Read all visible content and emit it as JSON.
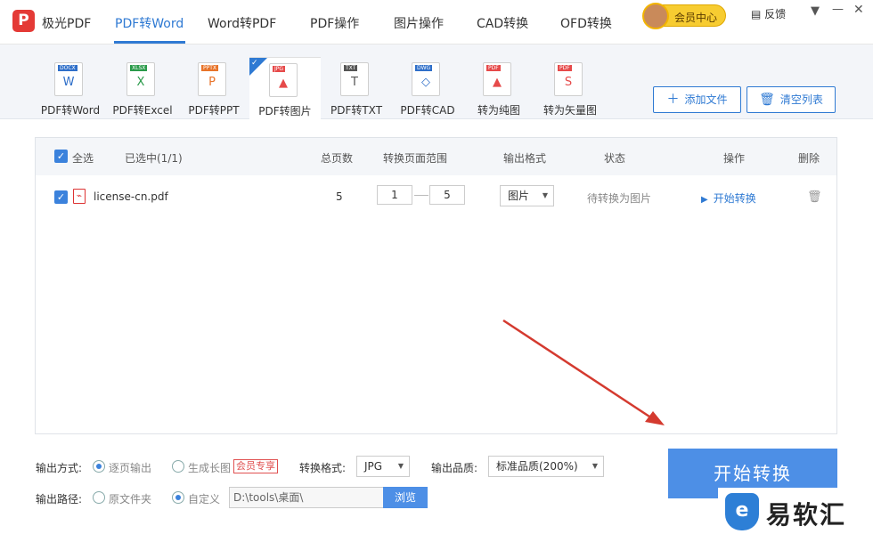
{
  "app": {
    "logo": "P",
    "name": "极光PDF"
  },
  "tabs": [
    {
      "label": "PDF转Word",
      "active": true
    },
    {
      "label": "Word转PDF"
    },
    {
      "label": "PDF操作"
    },
    {
      "label": "图片操作"
    },
    {
      "label": "CAD转换"
    },
    {
      "label": "OFD转换"
    }
  ],
  "header": {
    "member_label": "会员中心",
    "feedback_label": "反馈",
    "menu_icon": "chevron-down-icon",
    "minimize_icon": "minimize-icon",
    "close_icon": "close-icon"
  },
  "tools": [
    {
      "label": "PDF转Word",
      "tag": "DOCX",
      "tag_color": "#2f6fc9",
      "glyph": "W"
    },
    {
      "label": "PDF转Excel",
      "tag": "XLSX",
      "tag_color": "#2a9a4a",
      "glyph": "X"
    },
    {
      "label": "PDF转PPT",
      "tag": "PPTX",
      "tag_color": "#e8742a",
      "glyph": "P"
    },
    {
      "label": "PDF转图片",
      "tag": "JPG",
      "tag_color": "#e64a4a",
      "glyph": "▲",
      "active": true
    },
    {
      "label": "PDF转TXT",
      "tag": "TXT",
      "tag_color": "#555555",
      "glyph": "T"
    },
    {
      "label": "PDF转CAD",
      "tag": "DWG",
      "tag_color": "#2f6fc9",
      "glyph": "◇"
    },
    {
      "label": "转为纯图",
      "tag": "PDF",
      "tag_color": "#e64a4a",
      "glyph": "▲"
    },
    {
      "label": "转为矢量图",
      "tag": "PDF",
      "tag_color": "#e64a4a",
      "glyph": "S"
    }
  ],
  "toolbar": {
    "add_file": "添加文件",
    "clear_list": "清空列表"
  },
  "table": {
    "headers": {
      "select_all": "全选",
      "selected": "已选中(1/1)",
      "pages": "总页数",
      "range": "转换页面范围",
      "format": "输出格式",
      "status": "状态",
      "action": "操作",
      "delete": "删除"
    },
    "rows": [
      {
        "filename": "license-cn.pdf",
        "pages": "5",
        "range_start": "1",
        "range_end": "5",
        "format": "图片",
        "status": "待转换为图片",
        "action": "开始转换"
      }
    ]
  },
  "output": {
    "mode_label": "输出方式:",
    "mode_options": [
      "逐页输出",
      "生成长图"
    ],
    "vip_badge": "会员专享",
    "format_label": "转换格式:",
    "format_value": "JPG",
    "quality_label": "输出品质:",
    "quality_value": "标准品质(200%)",
    "path_label": "输出路径:",
    "path_options": [
      "原文件夹",
      "自定义"
    ],
    "path_value": "D:\\tools\\桌面\\",
    "browse_label": "浏览",
    "start_label": "开始转换"
  },
  "watermark": {
    "text": "易软汇"
  }
}
